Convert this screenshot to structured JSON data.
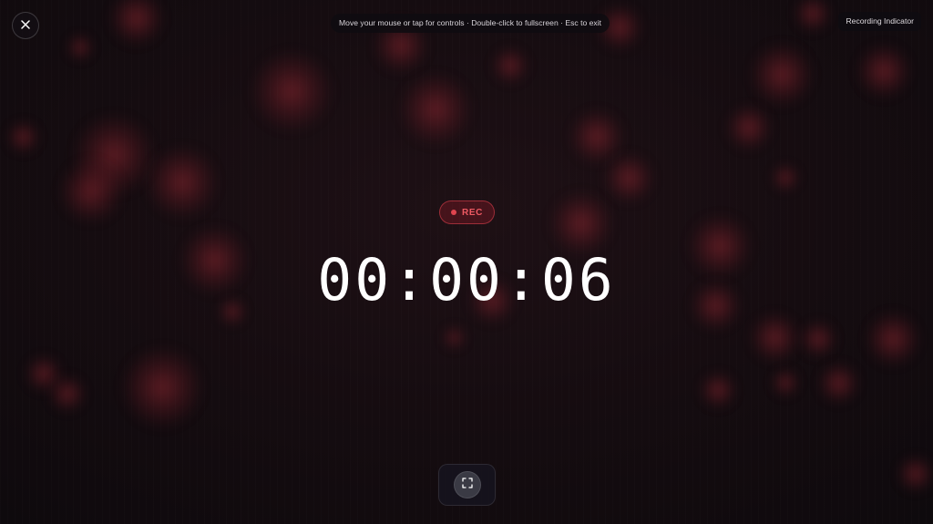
{
  "toolbar": {
    "close_icon": "close-icon",
    "hint_text": "Move your mouse or tap for controls · Double-click to fullscreen · Esc to exit",
    "title": "Recording Indicator"
  },
  "recording": {
    "badge_label": "REC",
    "elapsed": "00:00:06"
  },
  "controls": {
    "fullscreen_icon": "fullscreen-icon"
  },
  "colors": {
    "background": "#0e0a0d",
    "rec_accent": "#e0454f",
    "bokeh": "#962832",
    "timer_text": "#ffffff"
  }
}
